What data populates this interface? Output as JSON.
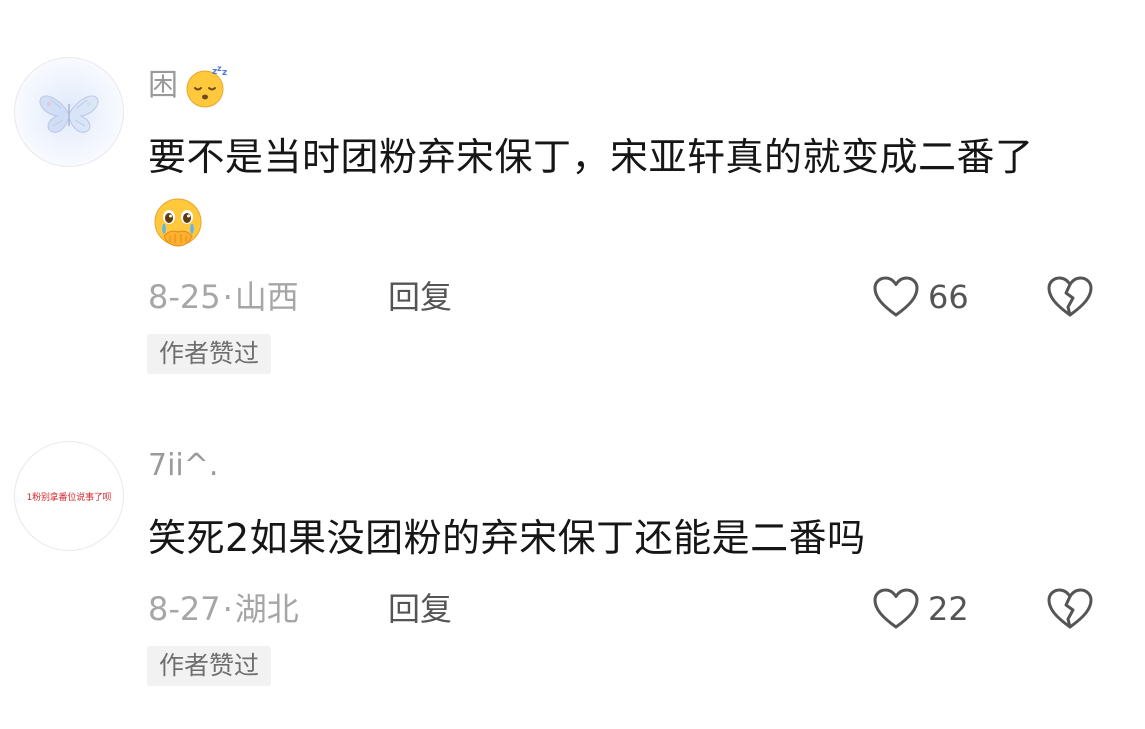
{
  "comments": [
    {
      "username": "困",
      "username_emoji": "sleeping-face-emoji",
      "text": "要不是当时团粉弃宋保丁，宋亚轩真的就变成二番了",
      "text_emoji": "crying-hands-over-mouth-emoji",
      "date": "8-25",
      "location": "山西",
      "reply_label": "回复",
      "like_count": "66",
      "badge": "作者赞过",
      "avatar": "butterfly-avatar"
    },
    {
      "username": "7ii^.",
      "text": "笑死2如果没团粉的弃宋保丁还能是二番吗",
      "date": "8-27",
      "location": "湖北",
      "reply_label": "回复",
      "like_count": "22",
      "badge": "作者赞过",
      "avatar_text": "1粉别拿番位说事了呗"
    }
  ],
  "meta_separator": "·",
  "colors": {
    "text": "#161616",
    "secondary": "#a6a6a6",
    "action": "#555555",
    "badge_bg": "#f2f2f2",
    "avatar_text": "#d4282f"
  }
}
